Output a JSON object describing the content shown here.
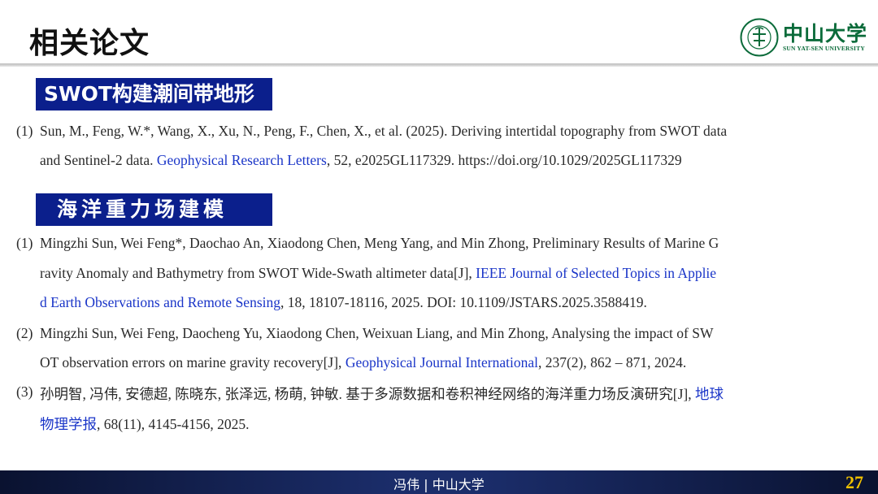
{
  "slide": {
    "title": "相关论文",
    "logo": {
      "cn": "中山大学",
      "en": "SUN YAT-SEN UNIVERSITY",
      "seal_text": "SUN YAT-SEN UNIVERSITY",
      "colors": {
        "brand_green": "#0b6b3a"
      }
    },
    "colors": {
      "section_bg": "#0b1f8c",
      "link": "#1a35c8",
      "page_number": "#f2c200"
    }
  },
  "sections": [
    {
      "header": "SWOT构建潮间带地形",
      "refs": [
        {
          "num": "(1)",
          "lines": [
            {
              "pre": "Sun, M., Feng, W.*, Wang, X., Xu, N., Peng, F., Chen, X., et al. (2025). Deriving intertidal topography from SWOT data",
              "link": "",
              "post": ""
            },
            {
              "pre": "and Sentinel-2 data. ",
              "link": "Geophysical Research Letters",
              "post": ", 52, e2025GL117329. https://doi.org/10.1029/2025GL117329"
            }
          ]
        }
      ]
    },
    {
      "header": "海洋重力场建模",
      "refs": [
        {
          "num": "(1)",
          "lines": [
            {
              "pre": "Mingzhi Sun, Wei Feng*, Daochao An, Xiaodong Chen, Meng Yang, and Min Zhong, Preliminary Results of Marine G",
              "link": "",
              "post": ""
            },
            {
              "pre": "ravity Anomaly and Bathymetry from SWOT Wide-Swath altimeter data[J], ",
              "link": "IEEE Journal of Selected Topics in Applie",
              "post": ""
            },
            {
              "pre": "",
              "link": "d Earth Observations and Remote Sensing",
              "post": ", 18, 18107-18116, 2025. DOI: 10.1109/JSTARS.2025.3588419."
            }
          ]
        },
        {
          "num": "(2)",
          "lines": [
            {
              "pre": "Mingzhi Sun, Wei Feng, Daocheng Yu, Xiaodong Chen, Weixuan Liang, and Min Zhong, Analysing the impact of SW",
              "link": "",
              "post": ""
            },
            {
              "pre": "OT observation errors on marine gravity recovery[J], ",
              "link": "Geophysical Journal International",
              "post": ", 237(2), 862 – 871, 2024."
            }
          ]
        },
        {
          "num": "(3)",
          "lines": [
            {
              "pre": "孙明智, 冯伟, 安德超, 陈晓东, 张泽远, 杨萌, 钟敏. 基于多源数据和卷积神经网络的海洋重力场反演研究[J], ",
              "link": "地球",
              "post": ""
            },
            {
              "pre": "",
              "link": "物理学报",
              "post": ", 68(11), 4145-4156, 2025."
            }
          ]
        }
      ]
    }
  ],
  "footer": {
    "text": "冯伟 | 中山大学",
    "page_number": "27"
  }
}
